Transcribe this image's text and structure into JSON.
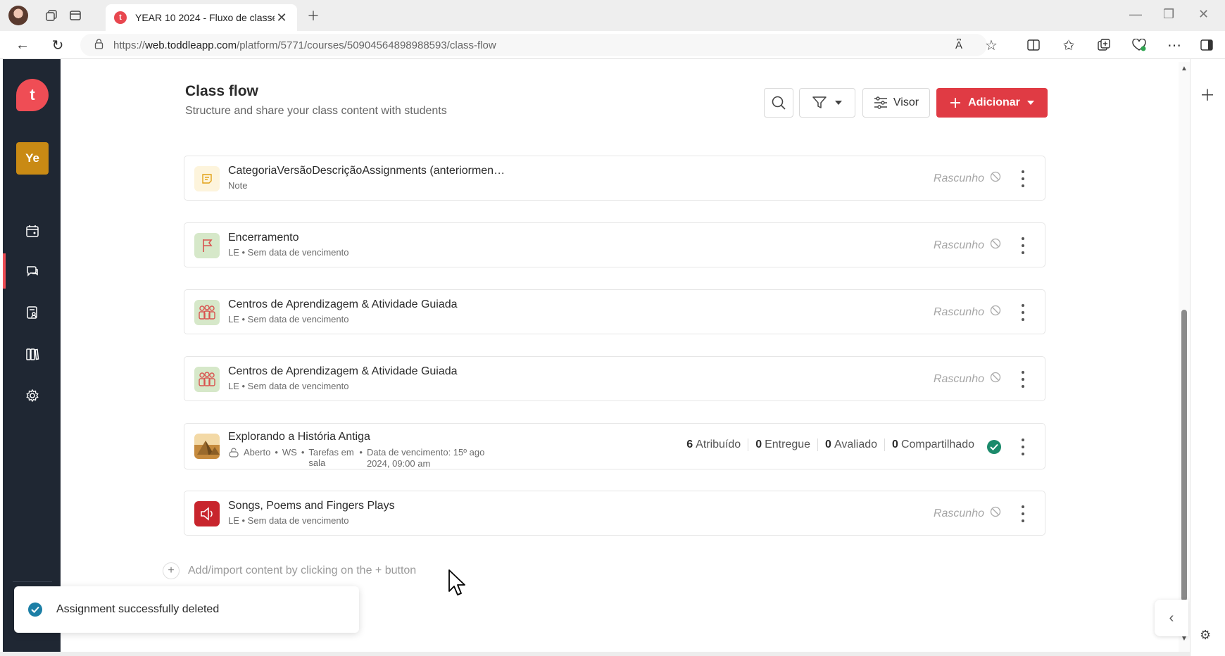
{
  "browser": {
    "tab_title": "YEAR 10 2024 - Fluxo de classe",
    "url_prefix": "https://",
    "url_host": "web.toddleapp.com",
    "url_path": "/platform/5771/courses/50904564898988593/class-flow"
  },
  "app": {
    "logo_letter": "t",
    "course_badge": "Ye",
    "accent_color": "#e03b44",
    "sidebar_color": "#1f2733"
  },
  "header": {
    "title": "Class flow",
    "subtitle": "Structure and share your class content with students",
    "visor_label": "Visor",
    "add_label": "Adicionar"
  },
  "items": [
    {
      "title": "CategoriaVersãoDescriçãoAssignments (anteriormen…",
      "meta": "Note",
      "status": "Rascunho",
      "icon": "note-icon"
    },
    {
      "title": "Encerramento",
      "meta": "LE • Sem data de vencimento",
      "status": "Rascunho",
      "icon": "flag-icon"
    },
    {
      "title": "Centros de Aprendizagem & Atividade Guiada",
      "meta": "LE • Sem data de vencimento",
      "status": "Rascunho",
      "icon": "group-icon"
    },
    {
      "title": "Centros de Aprendizagem & Atividade Guiada",
      "meta": "LE • Sem data de vencimento",
      "status": "Rascunho",
      "icon": "group-icon"
    },
    {
      "title": "Explorando a História Antiga",
      "meta_parts": {
        "status": "Aberto",
        "type": "WS",
        "category": "Tarefas em sala",
        "due": "Data de vencimento: 15º ago 2024, 09:00 am"
      },
      "stats": [
        {
          "count": "6",
          "label": "Atribuído"
        },
        {
          "count": "0",
          "label": "Entregue"
        },
        {
          "count": "0",
          "label": "Avaliado"
        },
        {
          "count": "0",
          "label": "Compartilhado"
        }
      ],
      "icon": "pyramid-image"
    },
    {
      "title": "Songs, Poems and Fingers Plays",
      "meta": "LE • Sem data de vencimento",
      "status": "Rascunho",
      "icon": "speaker-icon"
    }
  ],
  "add_hint": "Add/import content by clicking on the + button",
  "toast": "Assignment successfully deleted"
}
